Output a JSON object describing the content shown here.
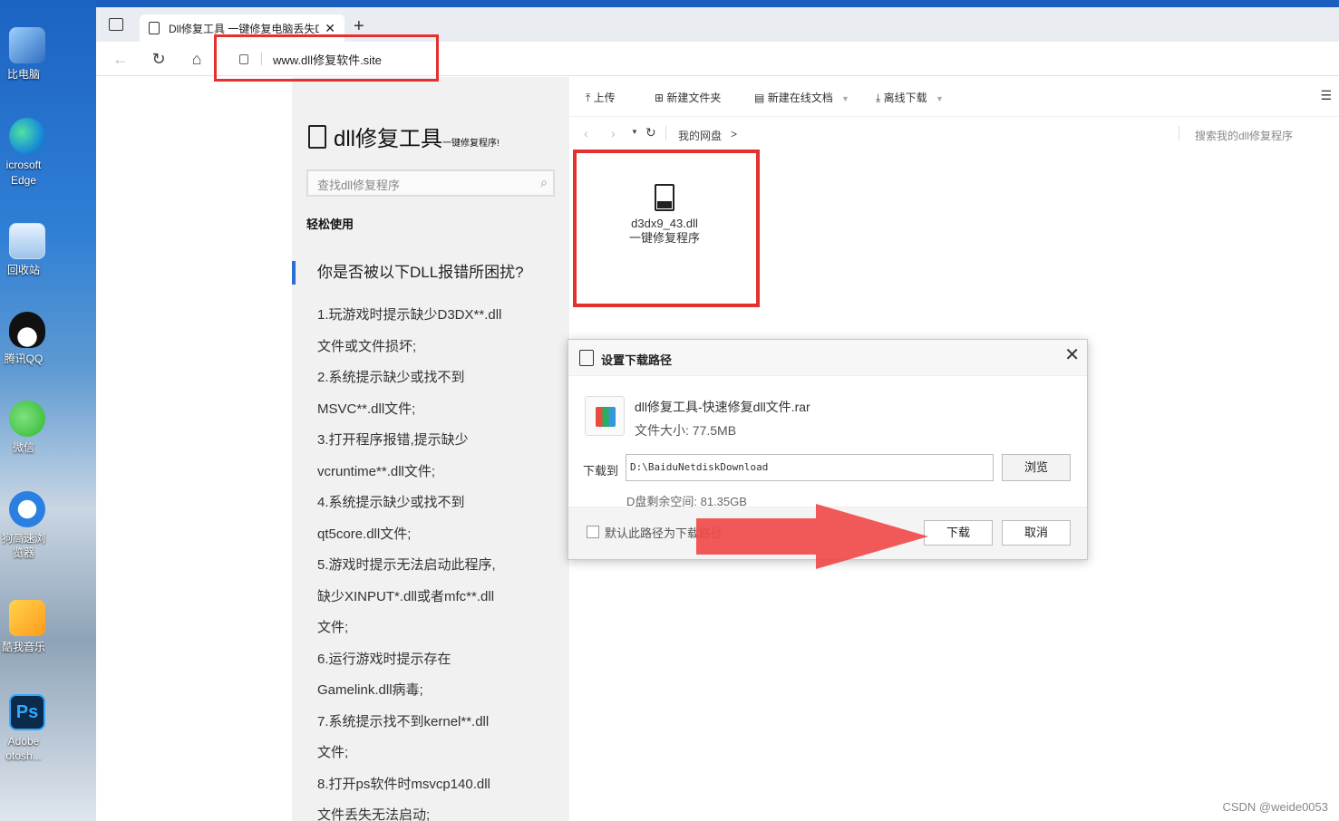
{
  "desktop": {
    "icons": [
      {
        "label": "比电脑",
        "icon": "computer-icon"
      },
      {
        "label": "icrosoft\nEdge",
        "icon": "edge-icon"
      },
      {
        "label": "回收站",
        "icon": "recycle-bin-icon"
      },
      {
        "label": "腾讯QQ",
        "icon": "qq-icon"
      },
      {
        "label": "微信",
        "icon": "wechat-icon"
      },
      {
        "label": "狗高速浏\n览器",
        "icon": "sogou-browser-icon"
      },
      {
        "label": "酷我音乐",
        "icon": "kuwo-music-icon"
      },
      {
        "label": "Adobe\notosh...",
        "icon": "photoshop-icon"
      }
    ]
  },
  "browser": {
    "tab_title": "Dll修复工具 一键修复电脑丢失Dl",
    "new_tab": "+",
    "url": "www.dll修复软件.site"
  },
  "left": {
    "brand_title": "dll修复工具",
    "brand_sub": "一键修复程序!",
    "search_placeholder": "查找dll修复程序",
    "easy_use": "轻松使用",
    "question": "你是否被以下DLL报错所困扰?",
    "lines": [
      "1.玩游戏时提示缺少D3DX**.dll",
      "文件或文件损坏;",
      "2.系统提示缺少或找不到",
      "MSVC**.dll文件;",
      "3.打开程序报错,提示缺少",
      "vcruntime**.dll文件;",
      "4.系统提示缺少或找不到",
      "qt5core.dll文件;",
      "5.游戏时提示无法启动此程序,",
      "缺少XINPUT*.dll或者mfc**.dll",
      "文件;",
      "6.运行游戏时提示存在",
      "Gamelink.dll病毒;",
      "7.系统提示找不到kernel**.dll",
      "文件;",
      "8.打开ps软件时msvcp140.dll",
      "文件丢失无法启动;"
    ]
  },
  "right": {
    "toolbar": {
      "upload": "上传",
      "new_folder": "新建文件夹",
      "new_online_doc": "新建在线文档",
      "offline_download": "离线下载"
    },
    "breadcrumb": "我的网盘",
    "breadcrumb_sep": ">",
    "search_placeholder": "搜索我的dll修复程序",
    "file_name": "d3dx9_43.dll",
    "file_sub": "一键修复程序"
  },
  "dialog": {
    "title": "设置下载路径",
    "file_name": "dll修复工具-快速修复dll文件.rar",
    "file_size": "文件大小: 77.5MB",
    "path_label": "下载到",
    "path_value": "D:\\BaiduNetdiskDownload",
    "browse": "浏览",
    "free_space": "D盘剩余空间: 81.35GB",
    "default_path": "默认此路径为下载路径",
    "download": "下载",
    "cancel": "取消"
  },
  "watermark": "CSDN @weide0053",
  "colors": {
    "highlight": "#e53030",
    "arrow": "#f04a4a",
    "accent": "#2a6fd1"
  }
}
